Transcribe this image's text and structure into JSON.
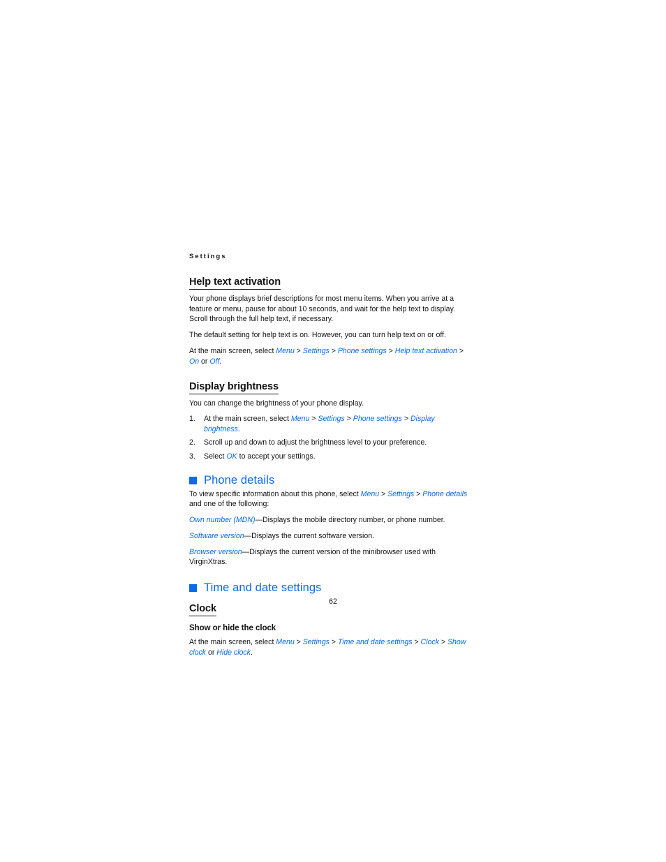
{
  "document": {
    "running_header": "Settings",
    "page_number": "62",
    "accent_color": "#0a6ae8",
    "text_color": "#141414",
    "background_color": "#ffffff"
  },
  "sections": {
    "help_text_activation": {
      "heading": "Help text activation",
      "paragraph_1": "Your phone displays brief descriptions for most menu items. When you arrive at a feature or menu, pause for about 10 seconds, and wait for the help text to display. Scroll through the full help text, if necessary.",
      "paragraph_2": "The default setting for help text is on. However, you can turn help text on or off.",
      "path_intro": "At the main screen, select ",
      "path_items": [
        "Menu",
        "Settings",
        "Phone settings",
        "Help text activation"
      ],
      "path_separator": " > ",
      "path_tail_option_1": "On",
      "path_tail_conjunction": " or ",
      "path_tail_option_2": "Off",
      "path_tail_period": "."
    },
    "display_brightness": {
      "heading": "Display brightness",
      "paragraph_1": "You can change the brightness of your phone display.",
      "steps": [
        {
          "number": "1.",
          "prefix": "At the main screen, select ",
          "path_items": [
            "Menu",
            "Settings",
            "Phone settings",
            "Display brightness"
          ],
          "suffix": "."
        },
        {
          "number": "2.",
          "prefix": "Scroll up and down to adjust the brightness level to your preference.",
          "path_items": [],
          "suffix": ""
        },
        {
          "number": "3.",
          "prefix": "Select ",
          "path_items": [
            "OK"
          ],
          "suffix": " to accept your settings."
        }
      ]
    },
    "phone_details": {
      "heading": "Phone details",
      "bullet_icon": "blue-square-bullet",
      "intro_prefix": "To view specific information about this phone, select ",
      "intro_path_items": [
        "Menu",
        "Settings",
        "Phone details"
      ],
      "intro_suffix": " and one of the following:",
      "definitions": [
        {
          "term": "Own number (MDN)",
          "dash": "—",
          "description": "Displays the mobile directory number, or phone number."
        },
        {
          "term": "Software version",
          "dash": "—",
          "description": "Displays the current software version."
        },
        {
          "term": "Browser version",
          "dash": "—",
          "description": "Displays the current version of the minibrowser used with VirginXtras."
        }
      ]
    },
    "time_and_date_settings": {
      "heading": "Time and date settings",
      "bullet_icon": "blue-square-bullet",
      "clock_heading": "Clock",
      "show_hide_heading": "Show or hide the clock",
      "path_intro": "At the main screen, select ",
      "path_items": [
        "Menu",
        "Settings",
        "Time and date settings",
        "Clock"
      ],
      "path_separator": " > ",
      "path_tail_option_1": "Show clock",
      "path_tail_conjunction": " or ",
      "path_tail_option_2": "Hide clock",
      "path_tail_period": "."
    }
  }
}
